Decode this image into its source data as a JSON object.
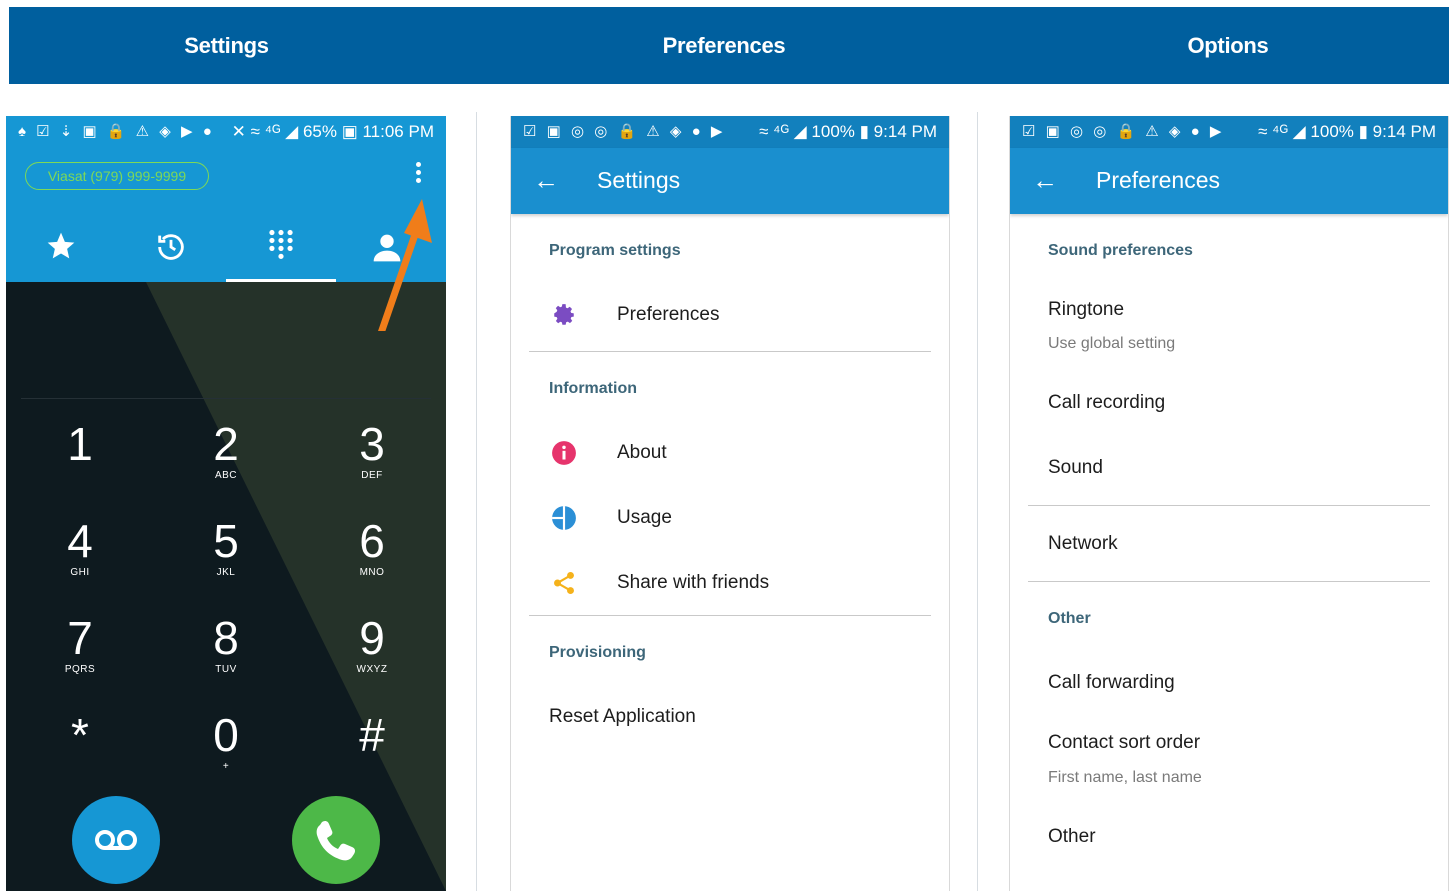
{
  "headers": {
    "col1": "Settings",
    "col2": "Preferences",
    "col3": "Options"
  },
  "phone1": {
    "status": {
      "left_icons": "♠ ☑ ⇣ ▣ 🔒 ⚠ ◈ ▶ ●",
      "right": "✕ ≈ ⁴ᴳ ◢ 65% ▣ 11:06 PM"
    },
    "caller_id": "Viasat (979) 999-9999",
    "tab_icons": [
      "star-icon",
      "history-icon",
      "dialpad-icon",
      "contacts-icon"
    ],
    "keys": [
      {
        "num": "1",
        "letters": ""
      },
      {
        "num": "2",
        "letters": "ABC"
      },
      {
        "num": "3",
        "letters": "DEF"
      },
      {
        "num": "4",
        "letters": "GHI"
      },
      {
        "num": "5",
        "letters": "JKL"
      },
      {
        "num": "6",
        "letters": "MNO"
      },
      {
        "num": "7",
        "letters": "PQRS"
      },
      {
        "num": "8",
        "letters": "TUV"
      },
      {
        "num": "9",
        "letters": "WXYZ"
      },
      {
        "num": "*",
        "letters": ""
      },
      {
        "num": "0",
        "letters": "+"
      },
      {
        "num": "#",
        "letters": ""
      }
    ],
    "colors": {
      "accent": "#1697d4",
      "call": "#4db848",
      "arrow": "#f07d1a",
      "pill": "#7ed957"
    }
  },
  "phone2": {
    "status": {
      "left_icons": "☑ ▣ ◎ ◎ 🔒 ⚠ ◈ ● ▶",
      "right": "≈ ⁴ᴳ ◢ 100% ▮ 9:14 PM"
    },
    "title": "Settings",
    "sections": {
      "program": "Program settings",
      "information": "Information",
      "provisioning": "Provisioning"
    },
    "items": {
      "preferences": "Preferences",
      "about": "About",
      "usage": "Usage",
      "share": "Share with friends",
      "reset": "Reset Application"
    }
  },
  "phone3": {
    "status": {
      "left_icons": "☑ ▣ ◎ ◎ 🔒 ⚠ ◈ ● ▶",
      "right": "≈ ⁴ᴳ ◢ 100% ▮ 9:14 PM"
    },
    "title": "Preferences",
    "sections": {
      "sound": "Sound preferences",
      "other": "Other"
    },
    "items": {
      "ringtone": "Ringtone",
      "ringtone_sub": "Use global setting",
      "call_recording": "Call recording",
      "sound": "Sound",
      "network": "Network",
      "call_forwarding": "Call forwarding",
      "contact_sort": "Contact sort order",
      "contact_sort_sub": "First name, last name",
      "other": "Other"
    }
  }
}
